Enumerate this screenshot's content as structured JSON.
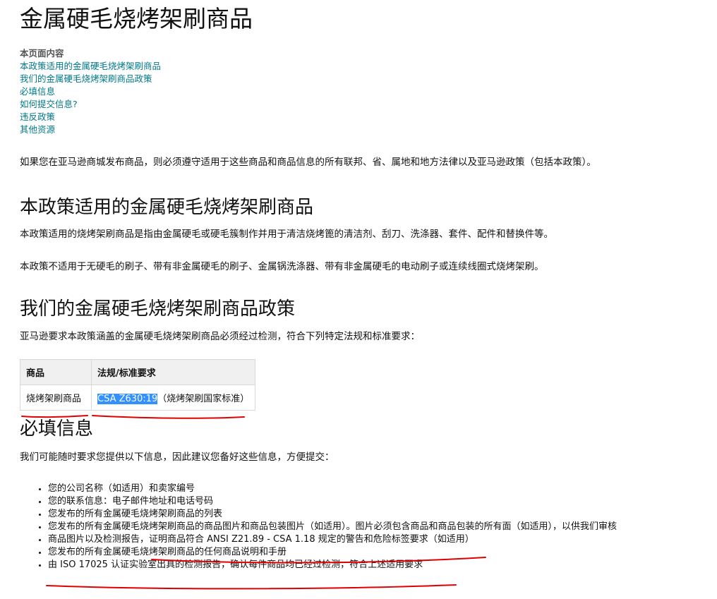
{
  "page": {
    "title": "金属硬毛烧烤架刷商品"
  },
  "toc": {
    "title": "本页面内容",
    "links": [
      "本政策适用的金属硬毛烧烤架刷商品",
      "我们的金属硬毛烧烤架刷商品政策",
      "必填信息",
      "如何提交信息?",
      "违反政策",
      "其他资源"
    ]
  },
  "intro": "如果您在亚马逊商城发布商品，则必须遵守适用于这些商品和商品信息的所有联邦、省、属地和地方法律以及亚马逊政策（包括本政策）。",
  "scope": {
    "heading": "本政策适用的金属硬毛烧烤架刷商品",
    "p1": "本政策适用的烧烤架刷商品是指由金属硬毛或硬毛簇制作并用于清洁烧烤篦的清洁剂、刮刀、洗涤器、套件、配件和替换件等。",
    "p2": "本政策不适用于无硬毛的刷子、带有非金属硬毛的刷子、金属锅洗涤器、带有非金属硬毛的电动刷子或连续线圈式烧烤架刷。"
  },
  "policy": {
    "heading": "我们的金属硬毛烧烤架刷商品政策",
    "p1": "亚马逊要求本政策涵盖的金属硬毛烧烤架刷商品必须经过检测，符合下列特定法规和标准要求：",
    "table": {
      "headers": [
        "商品",
        "法规/标准要求"
      ],
      "row": {
        "product": "烧烤架刷商品",
        "standard_code": "CSA Z630:19",
        "standard_desc": "（烧烤架刷国家标准）"
      }
    }
  },
  "required": {
    "heading": "必填信息",
    "p1": "我们可能随时要求您提供以下信息，因此建议您备好这些信息，方便提交：",
    "items": [
      "您的公司名称（如适用）和卖家编号",
      "您的联系信息：电子邮件地址和电话号码",
      "您发布的所有金属硬毛烧烤架刷商品的列表",
      "您发布的所有金属硬毛烧烤架刷商品的商品图片和商品包装图片（如适用）。图片必须包含商品和商品包装的所有面（如适用），以供我们审核",
      "商品图片以及检测报告，证明商品符合 ANSI Z21.89 - CSA 1.18 规定的警告和危险标签要求（如适用）",
      "您发布的所有金属硬毛烧烤架刷商品的任何商品说明和手册",
      "由 ISO 17025 认证实验室出具的检测报告，确认每件商品均已经过检测，符合上述适用要求"
    ]
  },
  "colors": {
    "link": "#00798a",
    "annotation": "#e00000",
    "selection": "#3390ff"
  }
}
